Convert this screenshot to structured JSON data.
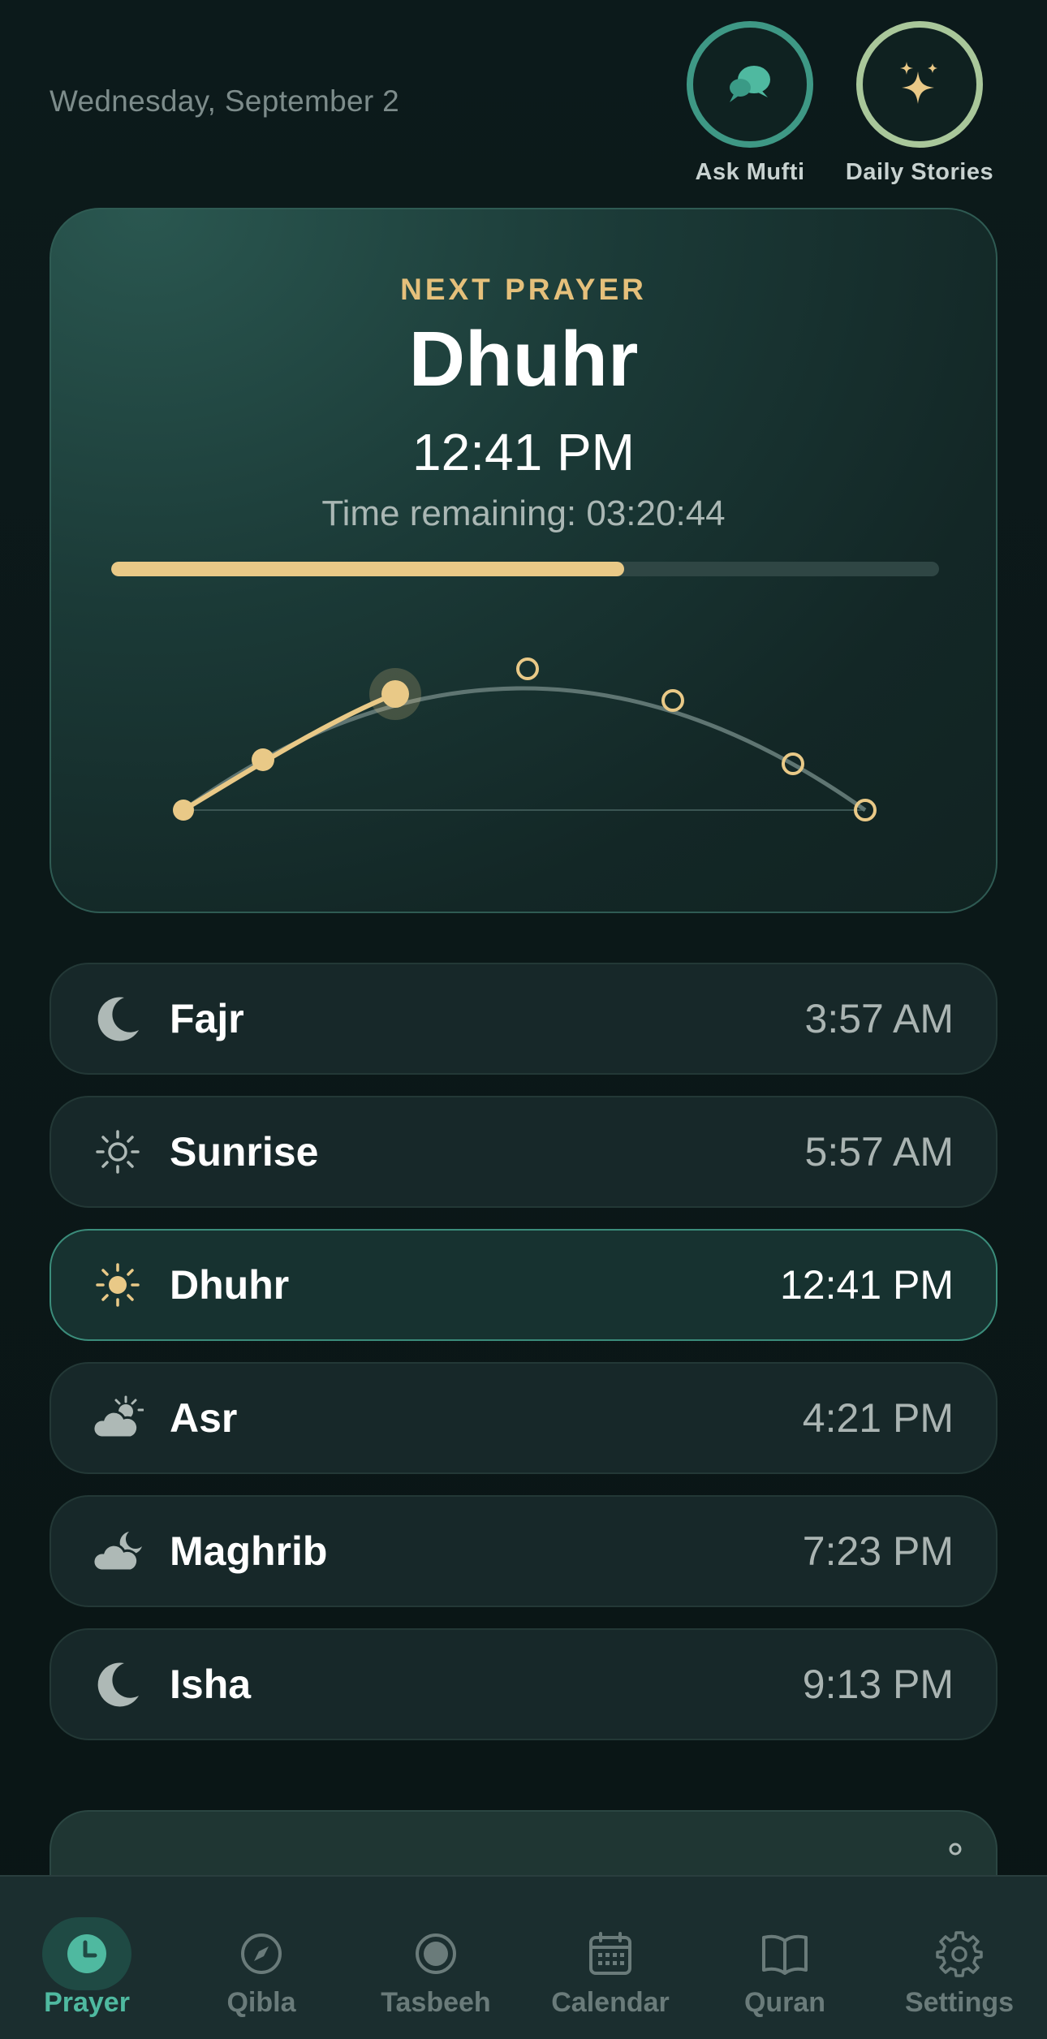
{
  "header": {
    "date": "Wednesday, September 2",
    "actions": [
      {
        "label": "Ask Mufti",
        "icon": "chat-bubbles-icon"
      },
      {
        "label": "Daily Stories",
        "icon": "sparkles-icon"
      }
    ]
  },
  "next_prayer": {
    "label": "NEXT PRAYER",
    "name": "Dhuhr",
    "time": "12:41 PM",
    "remaining": "Time remaining: 03:20:44",
    "progress": 0.62
  },
  "prayers": [
    {
      "name": "Fajr",
      "time": "3:57 AM",
      "icon": "moon-icon"
    },
    {
      "name": "Sunrise",
      "time": "5:57 AM",
      "icon": "sun-outline-icon"
    },
    {
      "name": "Dhuhr",
      "time": "12:41 PM",
      "icon": "sun-icon",
      "active": true
    },
    {
      "name": "Asr",
      "time": "4:21 PM",
      "icon": "cloud-sun-icon"
    },
    {
      "name": "Maghrib",
      "time": "7:23 PM",
      "icon": "cloud-moon-icon"
    },
    {
      "name": "Isha",
      "time": "9:13 PM",
      "icon": "moon-icon"
    }
  ],
  "tabs": [
    {
      "label": "Prayer",
      "icon": "clock-icon",
      "active": true
    },
    {
      "label": "Qibla",
      "icon": "compass-icon"
    },
    {
      "label": "Tasbeeh",
      "icon": "bead-icon"
    },
    {
      "label": "Calendar",
      "icon": "calendar-icon"
    },
    {
      "label": "Quran",
      "icon": "book-icon"
    },
    {
      "label": "Settings",
      "icon": "gear-icon"
    }
  ],
  "colors": {
    "accent_gold": "#e9c987",
    "accent_teal": "#4fb9a0"
  }
}
